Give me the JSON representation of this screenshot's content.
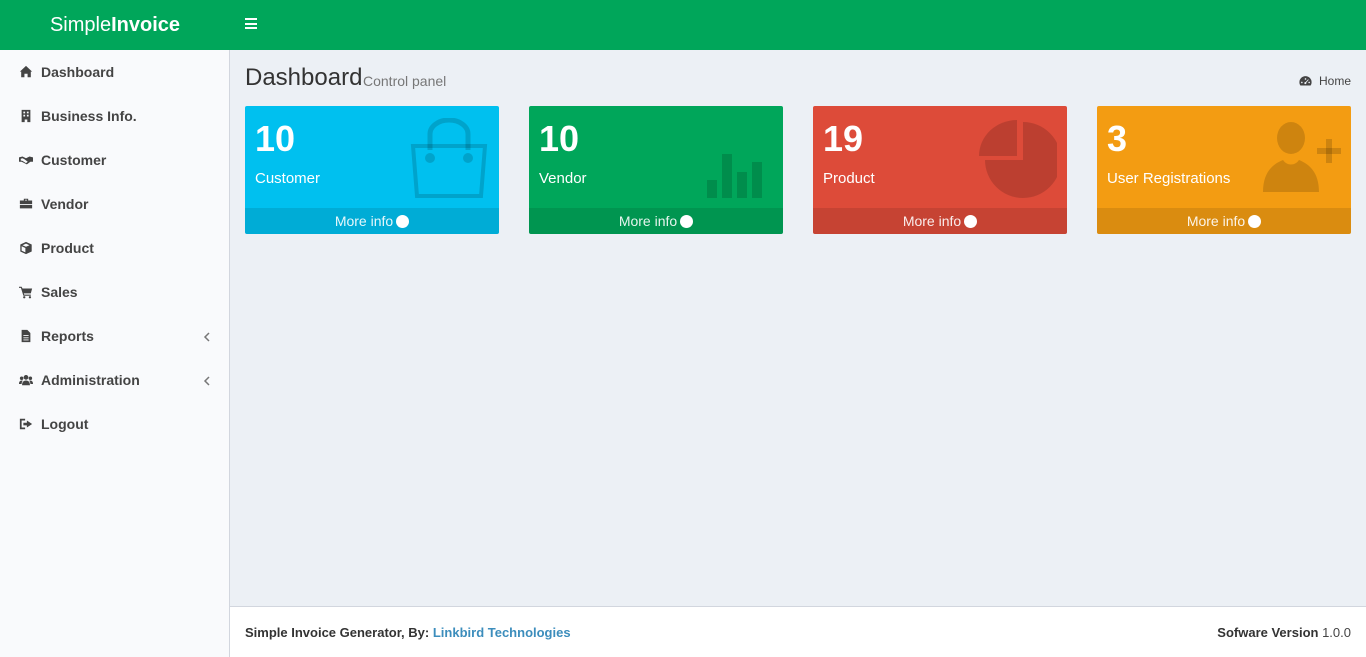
{
  "app": {
    "logo_light": "Simple",
    "logo_bold": "Invoice"
  },
  "sidebar": {
    "items": [
      {
        "label": "Dashboard",
        "icon": "home-icon"
      },
      {
        "label": "Business Info.",
        "icon": "building-icon"
      },
      {
        "label": "Customer",
        "icon": "handshake-icon"
      },
      {
        "label": "Vendor",
        "icon": "briefcase-icon"
      },
      {
        "label": "Product",
        "icon": "cube-icon"
      },
      {
        "label": "Sales",
        "icon": "cart-icon"
      },
      {
        "label": "Reports",
        "icon": "file-icon",
        "submenu": true
      },
      {
        "label": "Administration",
        "icon": "users-icon",
        "submenu": true
      },
      {
        "label": "Logout",
        "icon": "sign-out-icon"
      }
    ]
  },
  "header": {
    "title": "Dashboard",
    "subtitle": "Control panel",
    "breadcrumb": "Home"
  },
  "boxes": [
    {
      "count": "10",
      "label": "Customer",
      "more": "More info",
      "color": "#00c0ef",
      "icon": "shopping-bag-icon"
    },
    {
      "count": "10",
      "label": "Vendor",
      "more": "More info",
      "color": "#00a65a",
      "icon": "bar-chart-icon"
    },
    {
      "count": "19",
      "label": "Product",
      "more": "More info",
      "color": "#dd4b39",
      "icon": "pie-chart-icon"
    },
    {
      "count": "3",
      "label": "User Registrations",
      "more": "More info",
      "color": "#f39c12",
      "icon": "user-plus-icon"
    }
  ],
  "footer": {
    "credit_prefix": "Simple Invoice Generator, By:",
    "credit_link": "Linkbird Technologies",
    "version_label": "Sofware Version",
    "version": "1.0.0"
  }
}
